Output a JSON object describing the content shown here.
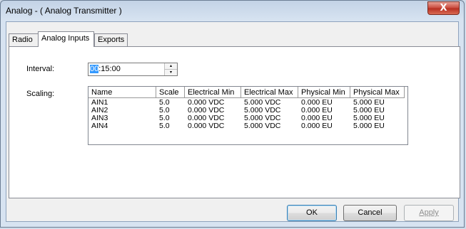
{
  "window": {
    "title": "Analog - ( Analog Transmitter )",
    "close_glyph": "X"
  },
  "tabs": [
    {
      "label": "Radio"
    },
    {
      "label": "Analog Inputs"
    },
    {
      "label": "Exports"
    }
  ],
  "interval": {
    "label": "Interval:",
    "selected_part": "00",
    "rest": ":15:00"
  },
  "scaling": {
    "label": "Scaling:",
    "columns": [
      "Name",
      "Scale",
      "Electrical Min",
      "Electrical Max",
      "Physical Min",
      "Physical Max"
    ],
    "rows": [
      [
        "AIN1",
        "5.0",
        "0.000 VDC",
        "5.000 VDC",
        "0.000 EU",
        "5.000 EU"
      ],
      [
        "AIN2",
        "5.0",
        "0.000 VDC",
        "5.000 VDC",
        "0.000 EU",
        "5.000 EU"
      ],
      [
        "AIN3",
        "5.0",
        "0.000 VDC",
        "5.000 VDC",
        "0.000 EU",
        "5.000 EU"
      ],
      [
        "AIN4",
        "5.0",
        "0.000 VDC",
        "5.000 VDC",
        "0.000 EU",
        "5.000 EU"
      ]
    ]
  },
  "buttons": {
    "ok": "OK",
    "cancel": "Cancel",
    "apply": "Apply"
  }
}
